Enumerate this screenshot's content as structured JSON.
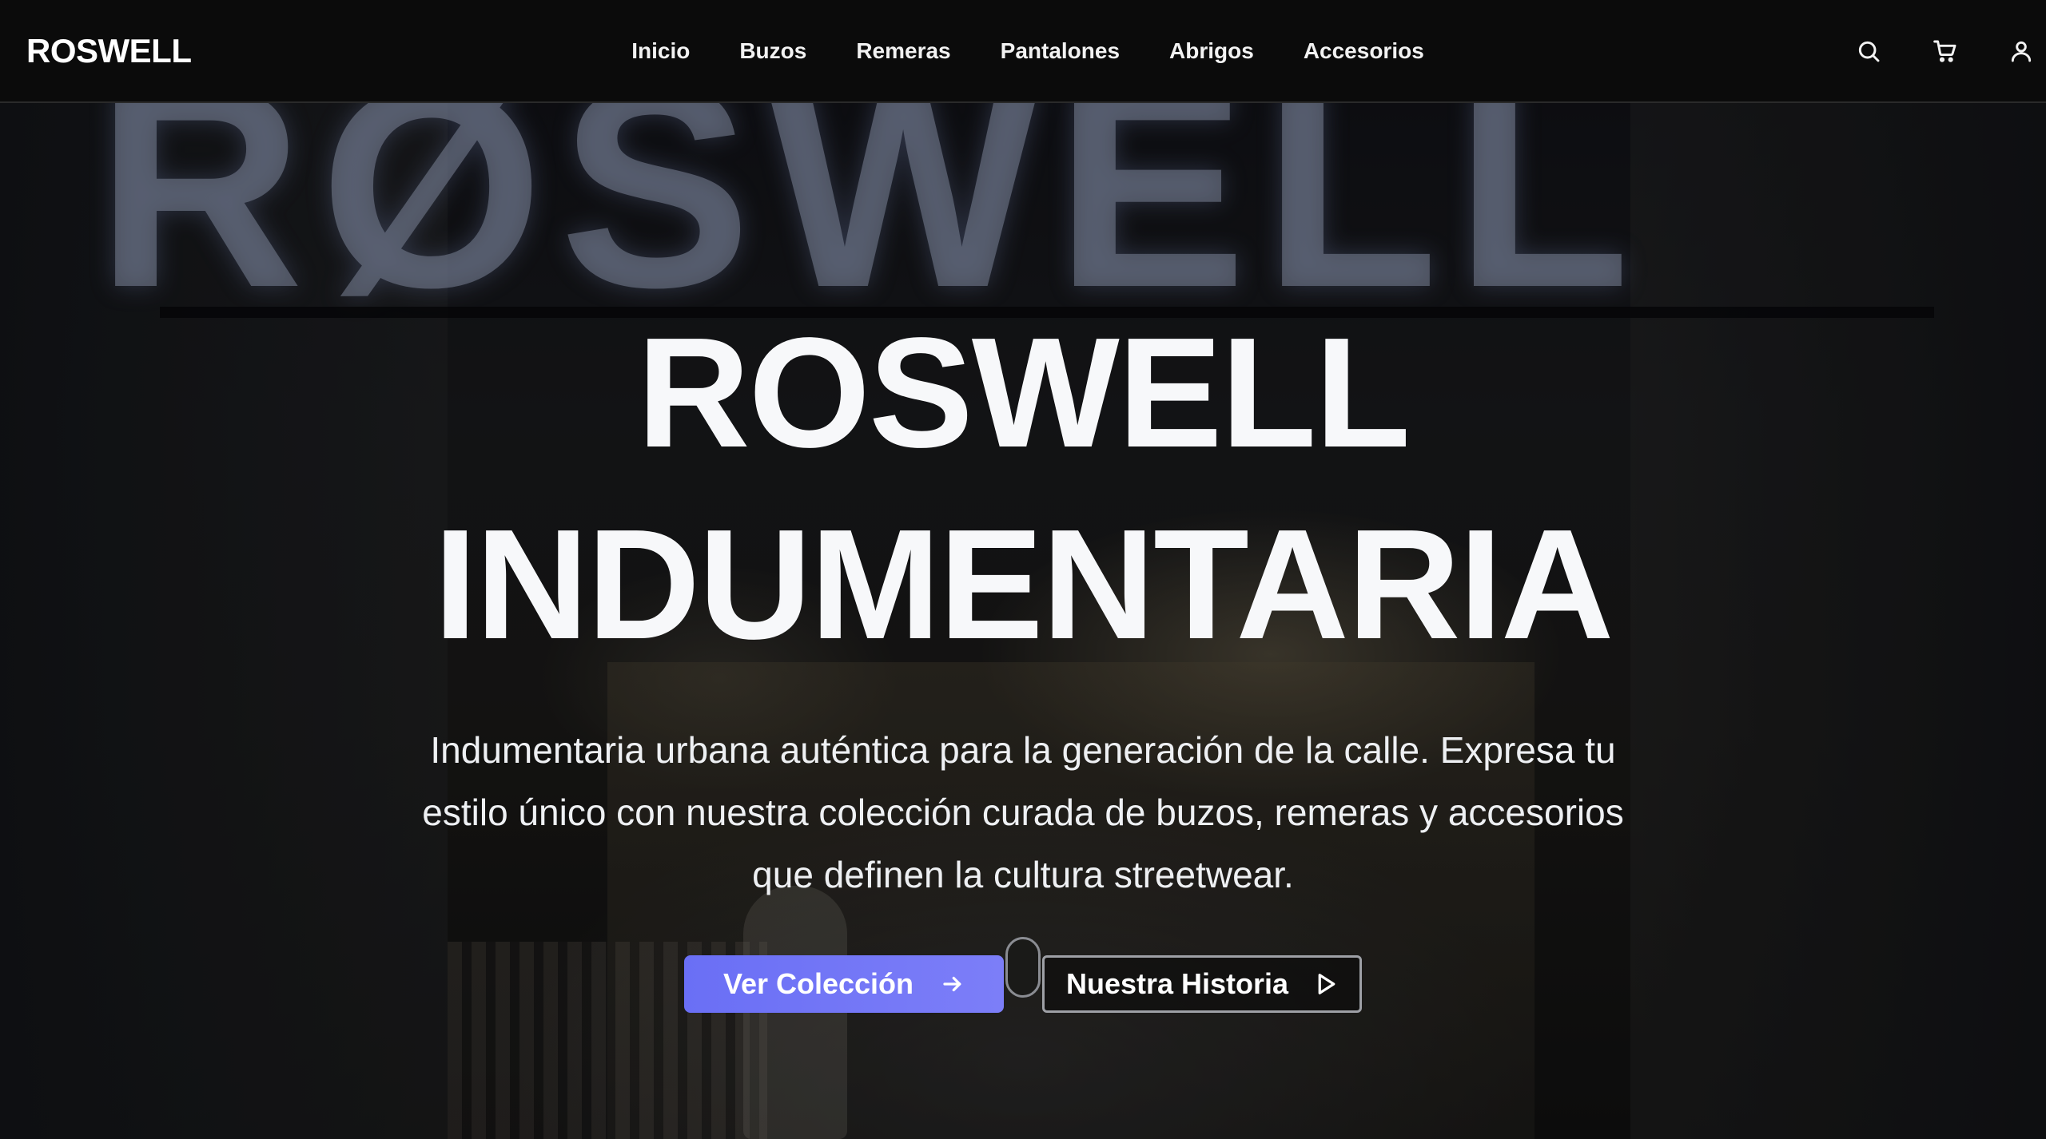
{
  "brand": {
    "name": "ROSWELL"
  },
  "nav": {
    "links": [
      {
        "label": "Inicio"
      },
      {
        "label": "Buzos"
      },
      {
        "label": "Remeras"
      },
      {
        "label": "Pantalones"
      },
      {
        "label": "Abrigos"
      },
      {
        "label": "Accesorios"
      }
    ],
    "icons": [
      "search-icon",
      "cart-icon",
      "user-icon"
    ]
  },
  "hero": {
    "title_line1": "ROSWELL",
    "title_line2": "INDUMENTARIA",
    "subtitle": "Indumentaria urbana auténtica para la generación de la calle. Expresa tu estilo único con nuestra colección curada de buzos, remeras y accesorios que definen la cultura streetwear.",
    "primary_button": "Ver Colección",
    "secondary_button": "Nuestra Historia",
    "background_sign": "RØSWELL"
  },
  "colors": {
    "accent": "#6a6ff5",
    "nav_bg": "#0b0b0b",
    "text": "#f7f8fa"
  }
}
